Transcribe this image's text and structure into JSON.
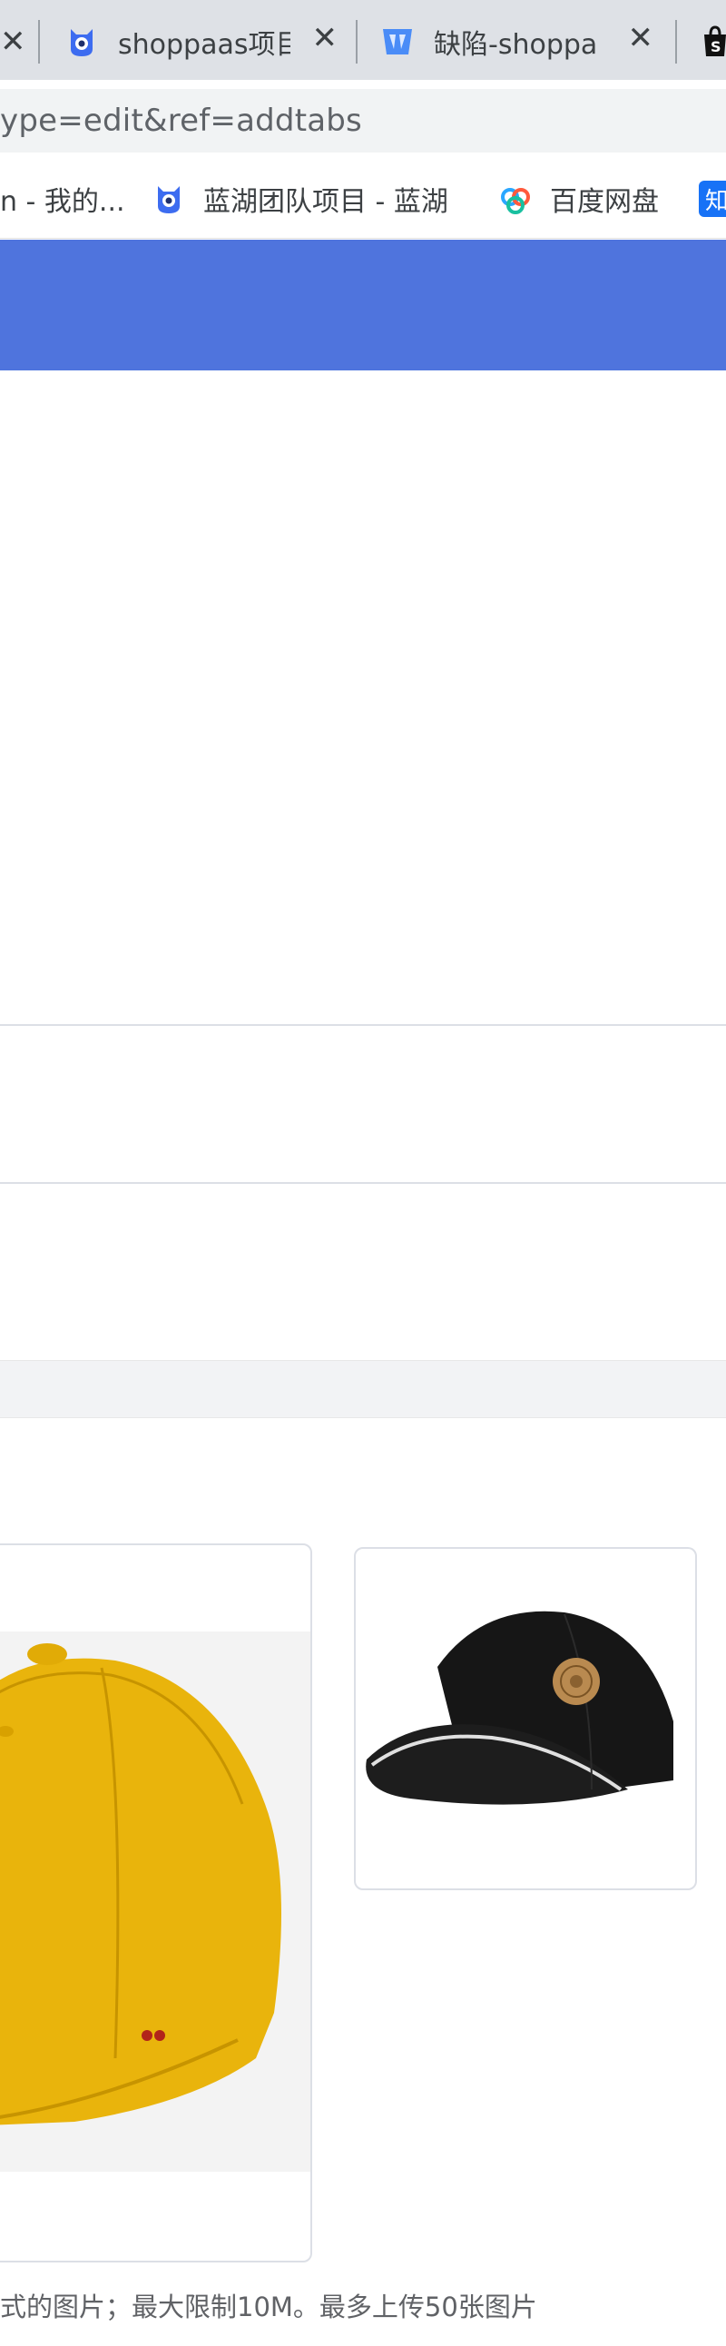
{
  "browser": {
    "tabs": [
      {
        "title": "shoppaas项目",
        "icon": "blue-lake-mascot-icon"
      },
      {
        "title": "缺陷-shoppa",
        "icon": "defect-tracker-icon"
      },
      {
        "title": "",
        "icon": "shopify-bag-icon"
      }
    ],
    "address": {
      "url": "ype=edit&ref=addtabs"
    },
    "bookmarks": [
      {
        "label": "n - 我的...",
        "icon": ""
      },
      {
        "label": "蓝湖团队项目 - 蓝湖",
        "icon": "blue-lake-mascot-icon"
      },
      {
        "label": "百度网盘",
        "icon": "baidu-netdisk-icon"
      },
      {
        "label": "知",
        "icon": "zhihu-icon"
      }
    ]
  },
  "app": {
    "header_color": "#4f74dd"
  },
  "upload": {
    "images": [
      {
        "name": "yellow-cap",
        "icon": "yellow-baseball-cap-image"
      },
      {
        "name": "black-cap",
        "icon": "black-baseball-cap-image"
      }
    ],
    "hint": "式的图片；最大限制10M。最多上传50张图片"
  },
  "colors": {
    "accent": "#4f74dd",
    "border": "#dcdfe6",
    "hint_text": "#606266"
  }
}
